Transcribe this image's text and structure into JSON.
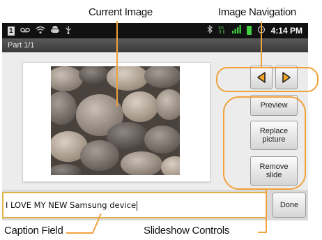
{
  "callouts": {
    "current_image": "Current Image",
    "image_navigation": "Image Navigation",
    "caption_field": "Caption Field",
    "slideshow_controls": "Slideshow Controls"
  },
  "status_bar": {
    "time": "4:14 PM",
    "left_icons": [
      "notification-badge-icon",
      "voicemail-icon",
      "wifi-icon",
      "android-icon",
      "usb-icon"
    ],
    "right_icons": [
      "bluetooth-icon",
      "network-icon",
      "signal-bars-icon",
      "battery-icon",
      "alarm-icon"
    ],
    "badge_text": "1"
  },
  "title_bar": {
    "title": "Part 1/1"
  },
  "controls": {
    "prev_icon": "left-triangle-icon",
    "next_icon": "right-triangle-icon",
    "preview_label": "Preview",
    "replace_label_line1": "Replace",
    "replace_label_line2": "picture",
    "remove_label_line1": "Remove",
    "remove_label_line2": "slide",
    "done_label": "Done"
  },
  "caption": {
    "value": "I LOVE MY NEW Samsung device"
  },
  "colors": {
    "highlight": "#f0a23c",
    "nav_arrow": "#f5a623",
    "caption_border": "#e2b24a"
  }
}
